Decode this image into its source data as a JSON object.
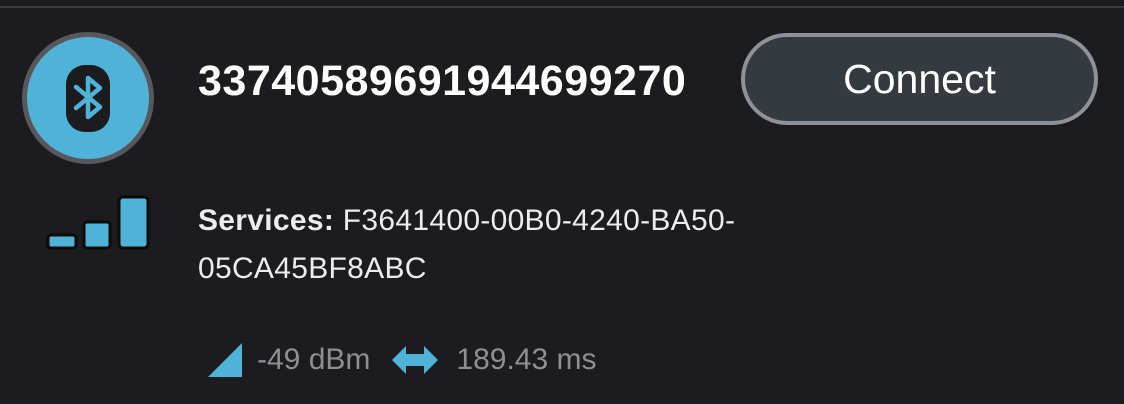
{
  "device": {
    "name": "33740589691944699270",
    "services_label": "Services:",
    "services_value": "F3641400-00B0-4240-BA50-05CA45BF8ABC",
    "avatar_icon": "bluetooth-icon",
    "signal_icon": "signal-strength-icon",
    "signal_level_fraction": 1.0,
    "connect_label": "Connect",
    "rssi": "-49 dBm",
    "rssi_icon": "rssi-triangle-icon",
    "latency": "189.43 ms",
    "latency_icon": "double-arrow-icon"
  },
  "colors": {
    "background": "#1c1c1e",
    "accent": "#4fb3d7",
    "button_background": "#353a41",
    "button_border": "#8e9197",
    "muted_text": "#8e8e93"
  }
}
